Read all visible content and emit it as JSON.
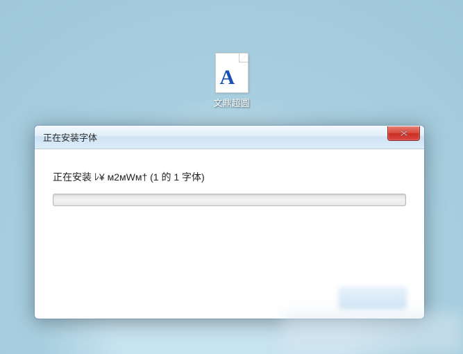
{
  "desktop": {
    "icon_glyph": "A",
    "icon_label": "文鼎超圆"
  },
  "dialog": {
    "title": "正在安装字体",
    "status": "正在安装 ﾚ¥ ᴍ2ᴍWᴍ† (1 的 1 字体)",
    "close_aria": "Close"
  }
}
